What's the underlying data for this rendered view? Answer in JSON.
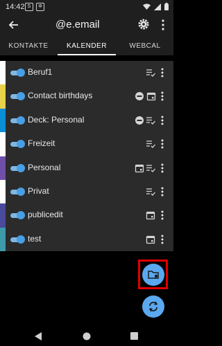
{
  "status_bar": {
    "time": "14:42",
    "badges": [
      "S",
      "Φ"
    ],
    "icons": [
      "wifi-icon",
      "signal-icon",
      "battery-icon"
    ]
  },
  "app_bar": {
    "title": "@e.email"
  },
  "tabs": [
    {
      "label": "KONTAKTE",
      "active": false
    },
    {
      "label": "KALENDER",
      "active": true
    },
    {
      "label": "WEBCAL",
      "active": false
    }
  ],
  "calendars": [
    {
      "name": "Beruf1",
      "color": "#ffffff",
      "enabled": true,
      "icons": [
        "sync-list-icon"
      ]
    },
    {
      "name": "Contact birthdays",
      "color": "#e8d24a",
      "enabled": true,
      "icons": [
        "read-only-icon",
        "event-icon"
      ]
    },
    {
      "name": "Deck: Personal",
      "color": "#0a8fd6",
      "enabled": true,
      "icons": [
        "read-only-icon",
        "sync-list-icon"
      ]
    },
    {
      "name": "Freizeit",
      "color": "#ffffff",
      "enabled": true,
      "icons": [
        "sync-list-icon"
      ]
    },
    {
      "name": "Personal",
      "color": "#6f4fa8",
      "enabled": true,
      "icons": [
        "event-icon",
        "sync-list-icon"
      ]
    },
    {
      "name": "Privat",
      "color": "#ffffff",
      "enabled": true,
      "icons": [
        "sync-list-icon"
      ]
    },
    {
      "name": "publicedit",
      "color": "#4a4a9c",
      "enabled": true,
      "icons": [
        "event-icon"
      ]
    },
    {
      "name": "test",
      "color": "#3d9aa8",
      "enabled": true,
      "icons": [
        "event-icon"
      ]
    }
  ],
  "fabs": [
    "create-calendar-icon",
    "sync-icon"
  ],
  "colors": {
    "accent": "#5aa8f0",
    "toggle": "#4a9ee3",
    "highlight": "#e00000"
  }
}
